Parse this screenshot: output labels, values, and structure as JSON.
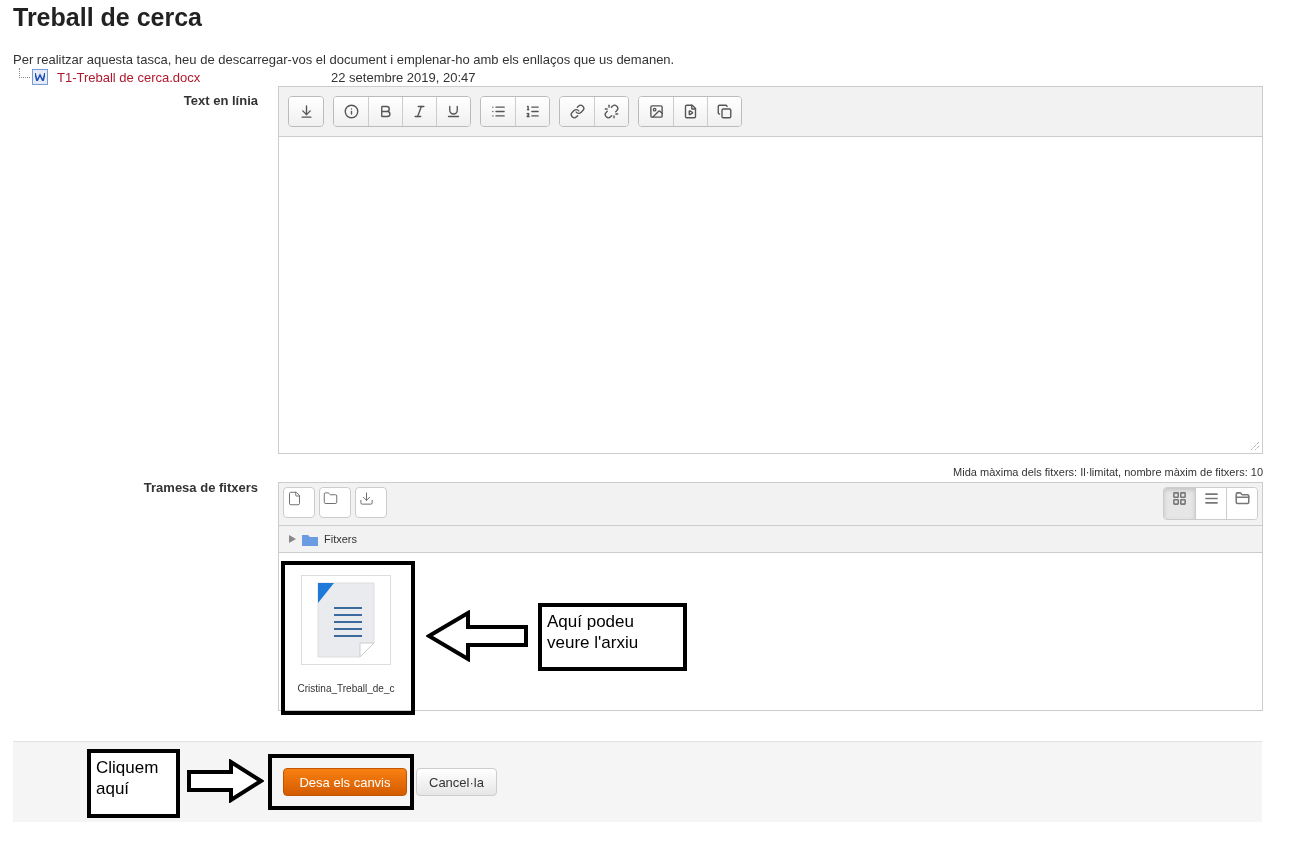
{
  "title": "Treball de cerca",
  "intro": "Per realitzar aquesta tasca, heu de descarregar-vos el document i emplenar-ho amb els enllaços que us demanen.",
  "attachment": {
    "name": "T1-Treball de cerca.docx",
    "date": "22 setembre 2019, 20:47"
  },
  "online_text": {
    "label": "Text en línia"
  },
  "file_submission": {
    "label": "Tramesa de fitxers",
    "limits": "Mida màxima dels fitxers: Il·limitat, nombre màxim de fitxers: 10",
    "views": [
      {
        "selected": true
      },
      {
        "selected": false
      },
      {
        "selected": false
      }
    ],
    "path": "Fitxers",
    "files": [
      {
        "name": "Cristina_Treball_de_c"
      }
    ]
  },
  "buttons": [
    {
      "kind": "primary",
      "label": "Desa els canvis"
    },
    {
      "kind": "default",
      "label": "Cancel·la"
    }
  ],
  "callouts": [
    {
      "lines": [
        "Aquí podeu",
        "veure l'arxiu"
      ]
    },
    {
      "lines": [
        "Cliquem",
        "aquí"
      ]
    }
  ]
}
